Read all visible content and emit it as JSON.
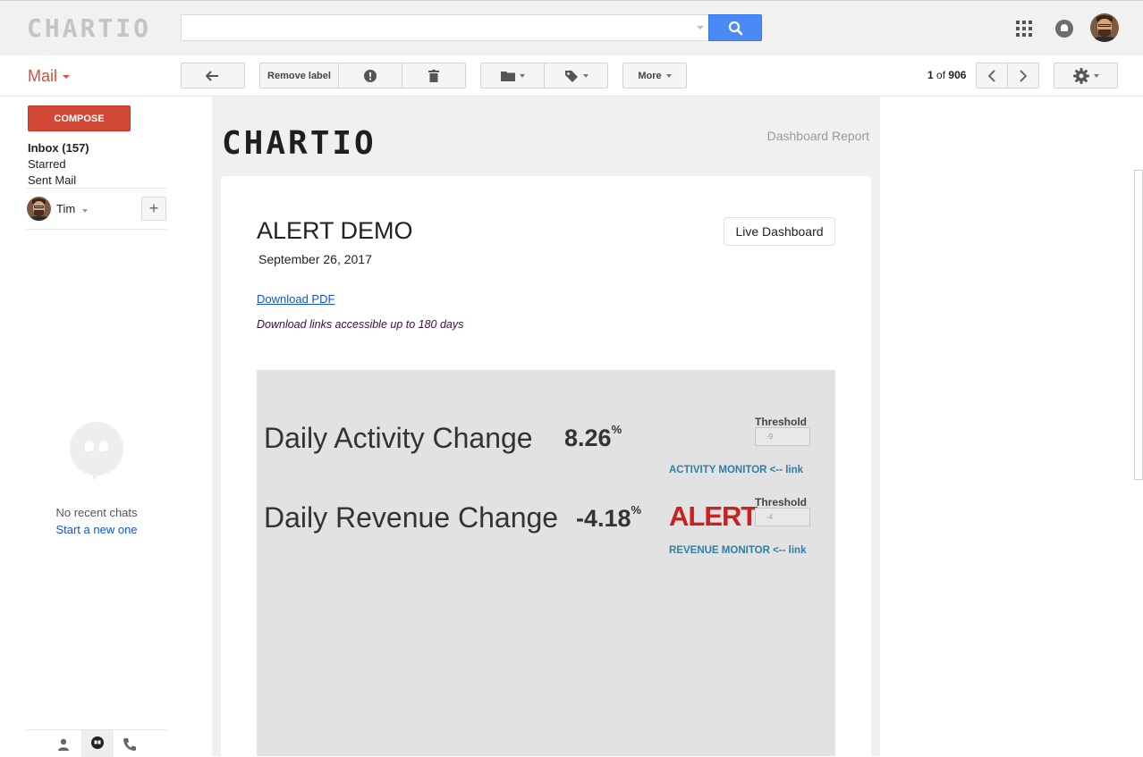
{
  "header": {
    "logo": "CHARTIO",
    "search": {
      "value": "",
      "placeholder": ""
    }
  },
  "toolbar": {
    "mail_label": "Mail",
    "remove_label": "Remove label",
    "more_label": "More",
    "pager": {
      "current": "1",
      "of_label": "of",
      "total": "906"
    }
  },
  "sidebar": {
    "compose_label": "COMPOSE",
    "items": [
      {
        "label": "Inbox (157)",
        "active": true
      },
      {
        "label": "Starred",
        "active": false
      },
      {
        "label": "Sent Mail",
        "active": false
      }
    ],
    "user_name": "Tim",
    "add_label": "+",
    "no_chats": "No recent chats",
    "start_chat": "Start a new one"
  },
  "email": {
    "logo": "CHARTIO",
    "report_label": "Dashboard Report",
    "title": "ALERT DEMO",
    "date": "September 26, 2017",
    "live_button": "Live Dashboard",
    "download_link": "Download PDF",
    "download_note": "Download links accessible up to 180 days",
    "metrics": [
      {
        "label": "Daily Activity Change",
        "value": "8.26",
        "unit": "%",
        "threshold_label": "Threshold",
        "threshold_value": "-9",
        "link": "ACTIVITY MONITOR <-- link",
        "alert": ""
      },
      {
        "label": "Daily Revenue Change",
        "value": "-4.18",
        "unit": "%",
        "threshold_label": "Threshold",
        "threshold_value": "-4",
        "link": "REVENUE MONITOR <-- link",
        "alert": "ALERT"
      }
    ]
  },
  "colors": {
    "accent_red": "#dd4b39",
    "compose_red": "#d14836",
    "search_blue": "#4a8af4",
    "alert_red": "#cc1f1f",
    "link_blue": "#1155cc",
    "monitor_link": "#2f7fa6"
  },
  "icons": [
    "search-icon",
    "apps-icon",
    "notifications-icon",
    "reply-icon",
    "report-spam-icon",
    "delete-icon",
    "folder-icon",
    "label-icon",
    "chevron-left-icon",
    "chevron-right-icon",
    "gear-icon",
    "hangouts-icon",
    "contacts-icon",
    "phone-icon"
  ]
}
